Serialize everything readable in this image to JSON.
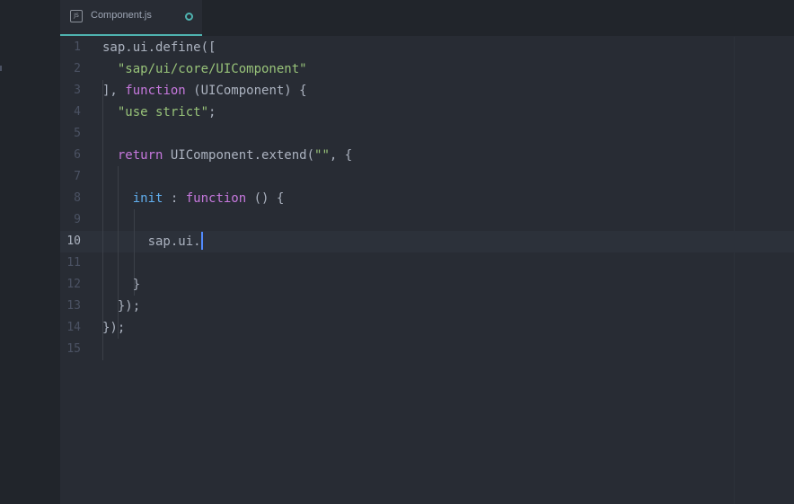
{
  "tab": {
    "icon_label": "JS",
    "title": "Component.js",
    "modified": true
  },
  "editor": {
    "active_line": 10,
    "lines": [
      {
        "num": "1",
        "tokens": [
          {
            "t": "plain",
            "v": "sap.ui.define(["
          }
        ]
      },
      {
        "num": "2",
        "tokens": [
          {
            "t": "plain",
            "v": "  "
          },
          {
            "t": "string",
            "v": "\"sap/ui/core/UIComponent\""
          }
        ]
      },
      {
        "num": "3",
        "tokens": [
          {
            "t": "plain",
            "v": "], "
          },
          {
            "t": "keyword",
            "v": "function"
          },
          {
            "t": "plain",
            "v": " (UIComponent) {"
          }
        ]
      },
      {
        "num": "4",
        "tokens": [
          {
            "t": "plain",
            "v": "  "
          },
          {
            "t": "string",
            "v": "\"use strict\""
          },
          {
            "t": "plain",
            "v": ";"
          }
        ]
      },
      {
        "num": "5",
        "tokens": []
      },
      {
        "num": "6",
        "tokens": [
          {
            "t": "plain",
            "v": "  "
          },
          {
            "t": "keyword",
            "v": "return"
          },
          {
            "t": "plain",
            "v": " UIComponent.extend("
          },
          {
            "t": "string",
            "v": "\"\""
          },
          {
            "t": "plain",
            "v": ", {"
          }
        ]
      },
      {
        "num": "7",
        "tokens": []
      },
      {
        "num": "8",
        "tokens": [
          {
            "t": "plain",
            "v": "    "
          },
          {
            "t": "prop",
            "v": "init"
          },
          {
            "t": "plain",
            "v": " : "
          },
          {
            "t": "keyword",
            "v": "function"
          },
          {
            "t": "plain",
            "v": " () {"
          }
        ]
      },
      {
        "num": "9",
        "tokens": []
      },
      {
        "num": "10",
        "tokens": [
          {
            "t": "plain",
            "v": "      sap.ui."
          }
        ],
        "cursor": true
      },
      {
        "num": "11",
        "tokens": []
      },
      {
        "num": "12",
        "tokens": [
          {
            "t": "plain",
            "v": "    }"
          }
        ]
      },
      {
        "num": "13",
        "tokens": [
          {
            "t": "plain",
            "v": "  });"
          }
        ]
      },
      {
        "num": "14",
        "tokens": [
          {
            "t": "plain",
            "v": "});"
          }
        ]
      },
      {
        "num": "15",
        "tokens": []
      }
    ]
  },
  "colors": {
    "background": "#282c34",
    "accent": "#4fb3b0",
    "string": "#98c379",
    "keyword": "#c678dd",
    "property": "#61afef",
    "cursor": "#528bff"
  }
}
